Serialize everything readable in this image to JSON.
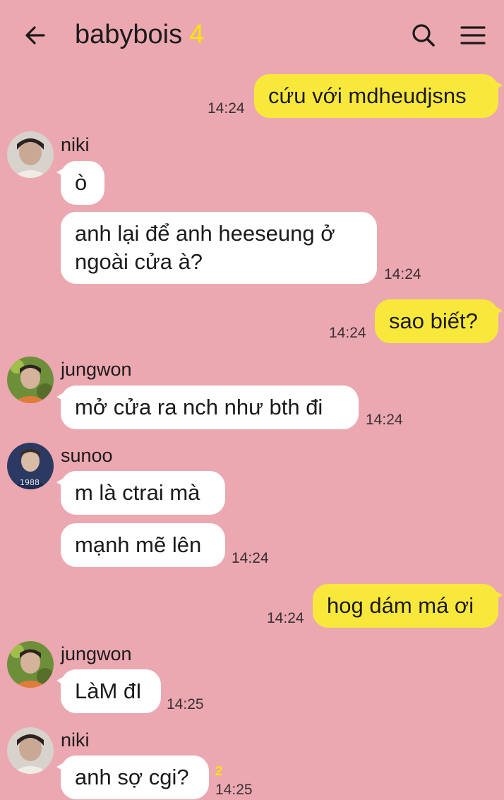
{
  "header": {
    "title": "babybois",
    "member_count": "4",
    "back_icon": "arrow-left-icon",
    "search_icon": "search-icon",
    "menu_icon": "hamburger-menu-icon"
  },
  "colors": {
    "background": "#eba8b0",
    "my_bubble": "#f9e83c",
    "their_bubble": "#ffffff",
    "accent_count": "#f7e600"
  },
  "messages": [
    {
      "text": "cứu với mdheudjsns",
      "time": "14:24"
    },
    {
      "sender": "niki",
      "text": "ò"
    },
    {
      "text_line1": "anh lại để anh heeseung ở",
      "text_line2": "ngoài cửa à?",
      "time": "14:24"
    },
    {
      "text": "sao biết?",
      "time": "14:24"
    },
    {
      "sender": "jungwon",
      "text": "mở cửa ra nch như bth đi",
      "time": "14:24"
    },
    {
      "sender": "sunoo",
      "text": "m là ctrai mà"
    },
    {
      "text": "mạnh mẽ lên",
      "time": "14:24"
    },
    {
      "text": "hog dám má ơi",
      "time": "14:24"
    },
    {
      "sender": "jungwon",
      "text": "LàM đI",
      "time": "14:25"
    },
    {
      "sender": "niki",
      "text": "anh sợ cgi?",
      "time": "14:25",
      "unread": "2"
    }
  ]
}
